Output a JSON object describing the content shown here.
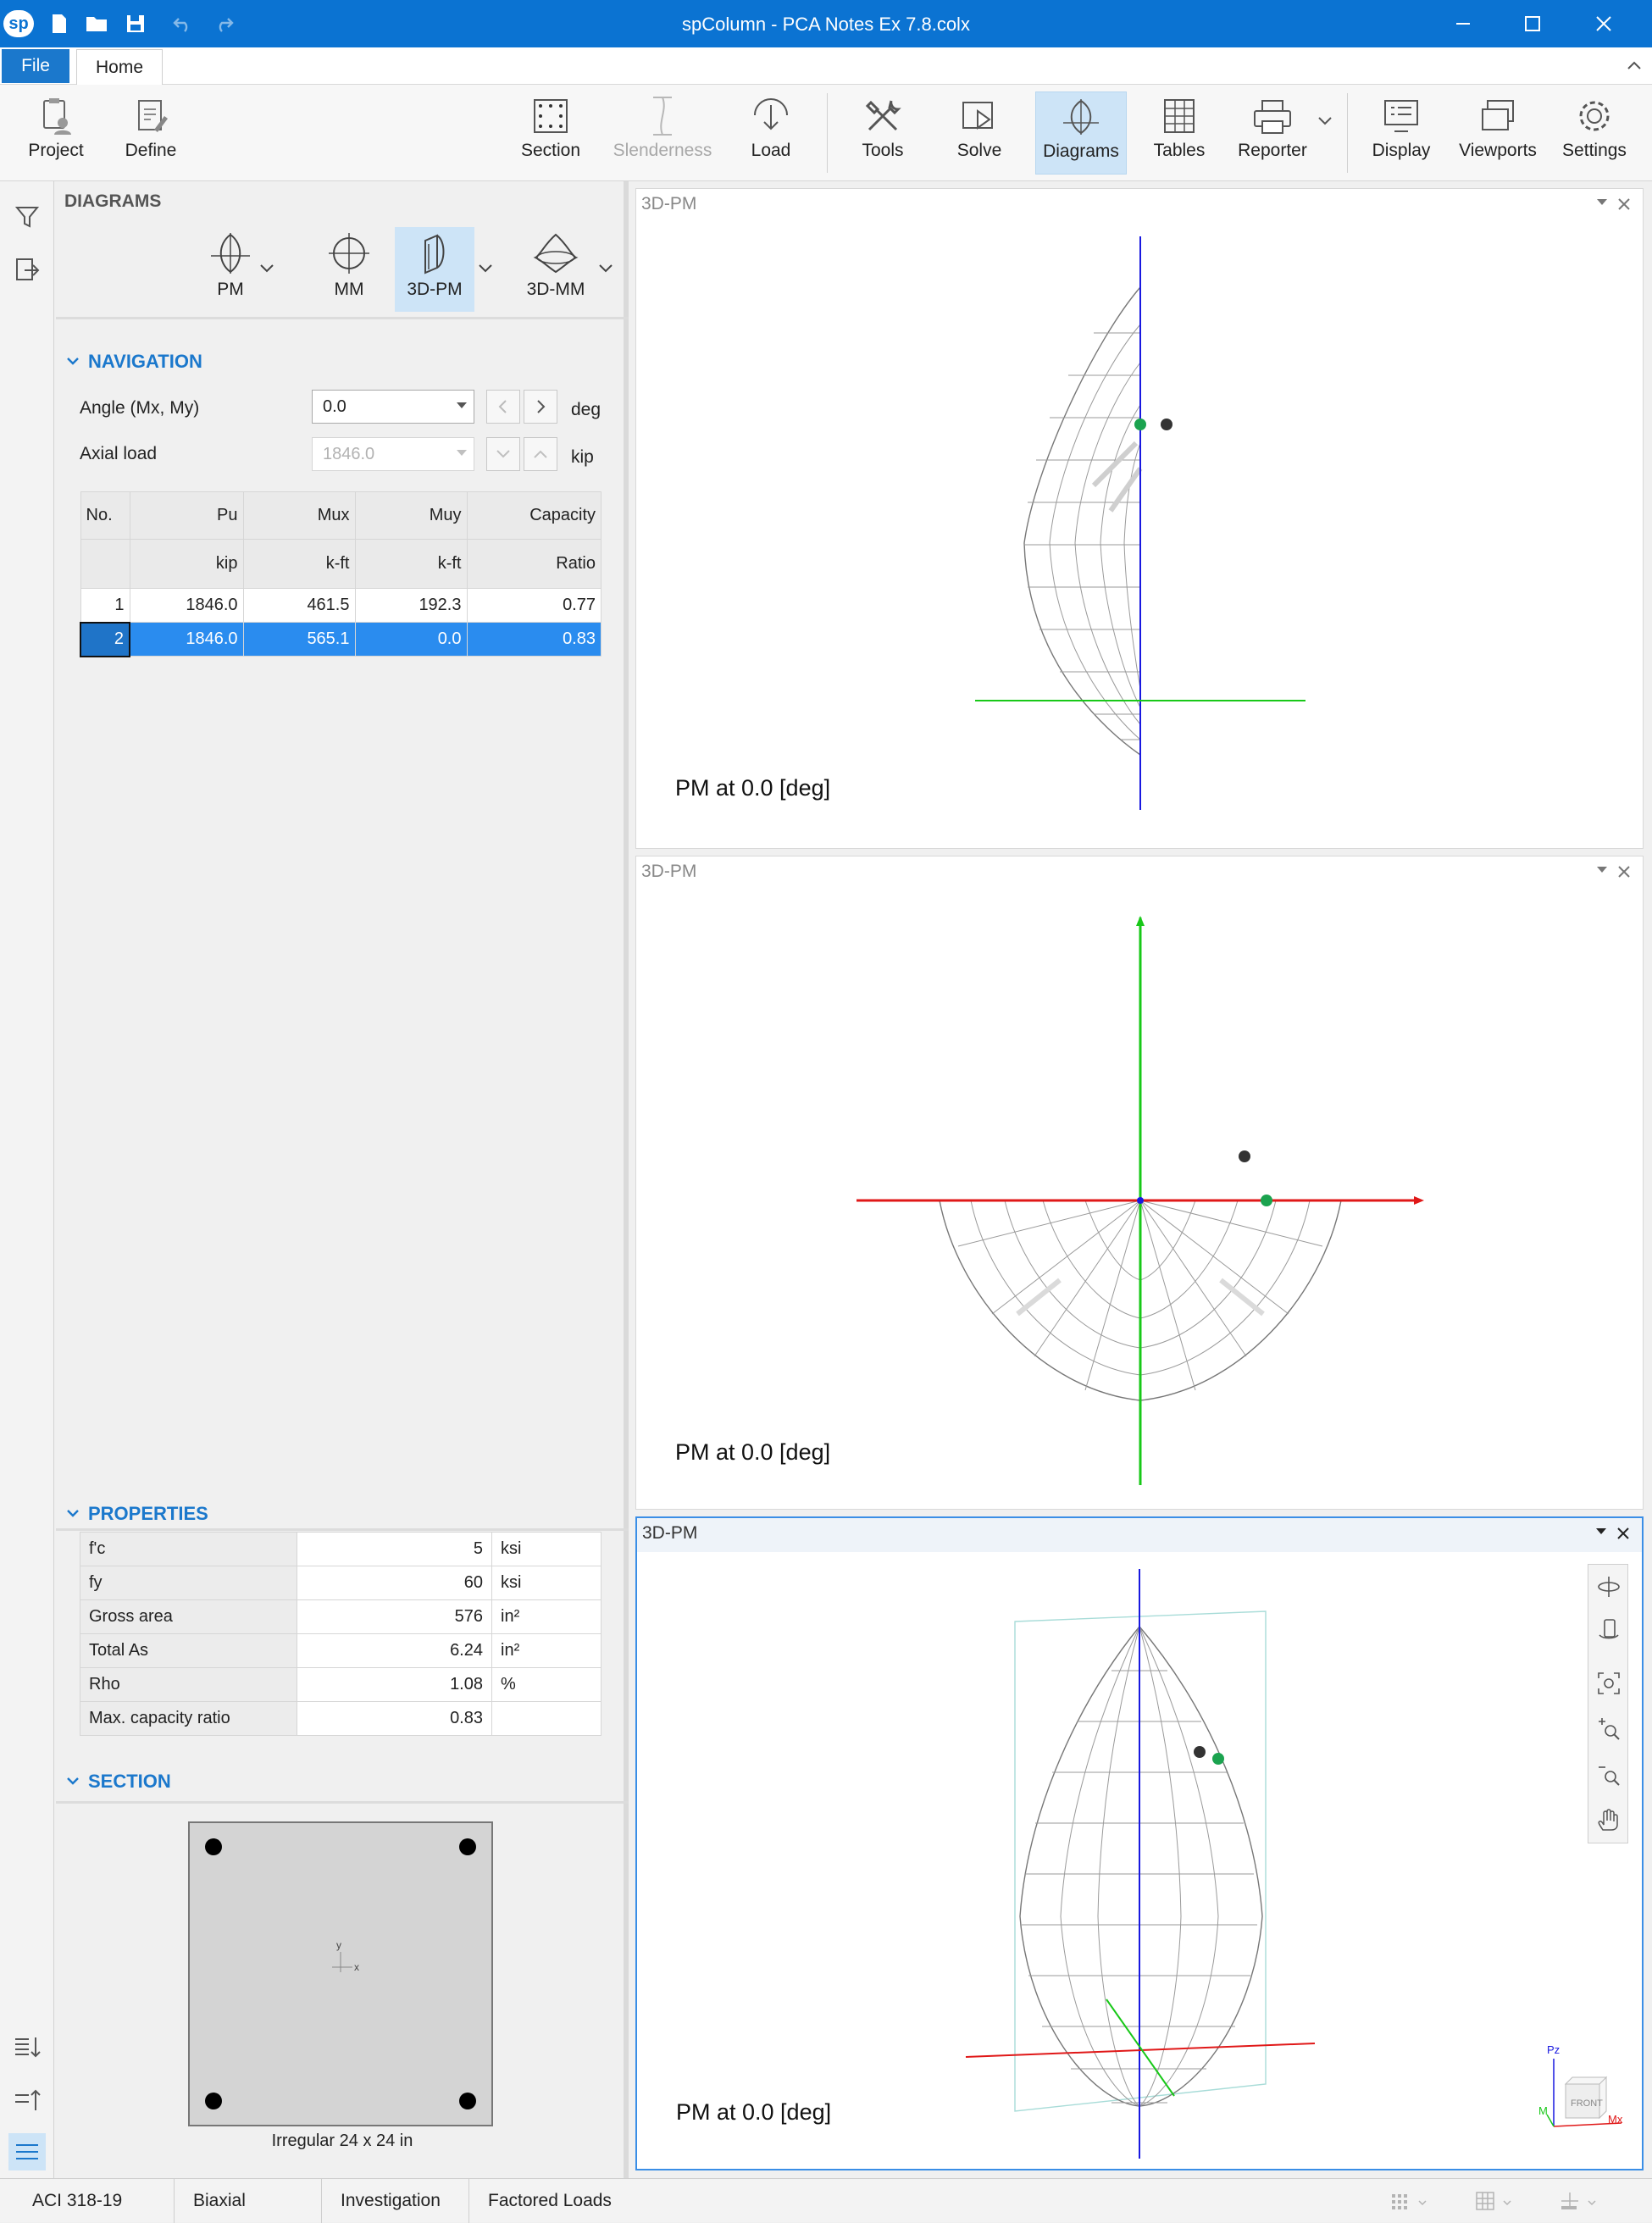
{
  "window": {
    "title": "spColumn - PCA Notes Ex 7.8.colx",
    "logo": "sp"
  },
  "ribbon_tabs": {
    "file": "File",
    "home": "Home"
  },
  "ribbon": {
    "project": "Project",
    "define": "Define",
    "section": "Section",
    "slenderness": "Slenderness",
    "load": "Load",
    "tools": "Tools",
    "solve": "Solve",
    "diagrams": "Diagrams",
    "tables": "Tables",
    "reporter": "Reporter",
    "display": "Display",
    "viewports": "Viewports",
    "settings": "Settings"
  },
  "panel": {
    "title": "DIAGRAMS",
    "diagram_types": {
      "pm": "PM",
      "mm": "MM",
      "pm3d": "3D-PM",
      "mm3d": "3D-MM"
    },
    "navigation": {
      "header": "NAVIGATION",
      "angle_label": "Angle (Mx, My)",
      "angle_value": "0.0",
      "angle_unit": "deg",
      "axial_label": "Axial load",
      "axial_value": "1846.0",
      "axial_unit": "kip"
    },
    "load_table": {
      "headers": [
        "No.",
        "Pu",
        "Mux",
        "Muy",
        "Capacity"
      ],
      "units": [
        "",
        "kip",
        "k-ft",
        "k-ft",
        "Ratio"
      ],
      "rows": [
        [
          "1",
          "1846.0",
          "461.5",
          "192.3",
          "0.77"
        ],
        [
          "2",
          "1846.0",
          "565.1",
          "0.0",
          "0.83"
        ]
      ]
    },
    "properties": {
      "header": "PROPERTIES",
      "rows": [
        [
          "f'c",
          "5",
          "ksi"
        ],
        [
          "fy",
          "60",
          "ksi"
        ],
        [
          "Gross area",
          "576",
          "in²"
        ],
        [
          "Total As",
          "6.24",
          "in²"
        ],
        [
          "Rho",
          "1.08",
          "%"
        ],
        [
          "Max. capacity ratio",
          "0.83",
          ""
        ]
      ]
    },
    "section": {
      "header": "SECTION",
      "caption": "Irregular 24 x 24 in",
      "axis_x": "x",
      "axis_y": "y"
    }
  },
  "viewports": [
    {
      "title": "3D-PM",
      "caption": "PM at 0.0 [deg]"
    },
    {
      "title": "3D-PM",
      "caption": "PM at 0.0 [deg]"
    },
    {
      "title": "3D-PM",
      "caption": "PM at 0.0 [deg]",
      "active": true
    }
  ],
  "view_cube": {
    "face": "FRONT",
    "pz": "Pz",
    "mx": "Mx",
    "my": "M"
  },
  "statusbar": {
    "code": "ACI 318-19",
    "mode": "Biaxial",
    "run": "Investigation",
    "loads": "Factored Loads"
  },
  "colors": {
    "accent": "#0b73d2",
    "selected_row": "#2a8cef",
    "axis_p": "#1818e0",
    "axis_green": "#18c818",
    "axis_red": "#e01818",
    "point_green": "#1ba34f",
    "point_black": "#333333"
  }
}
